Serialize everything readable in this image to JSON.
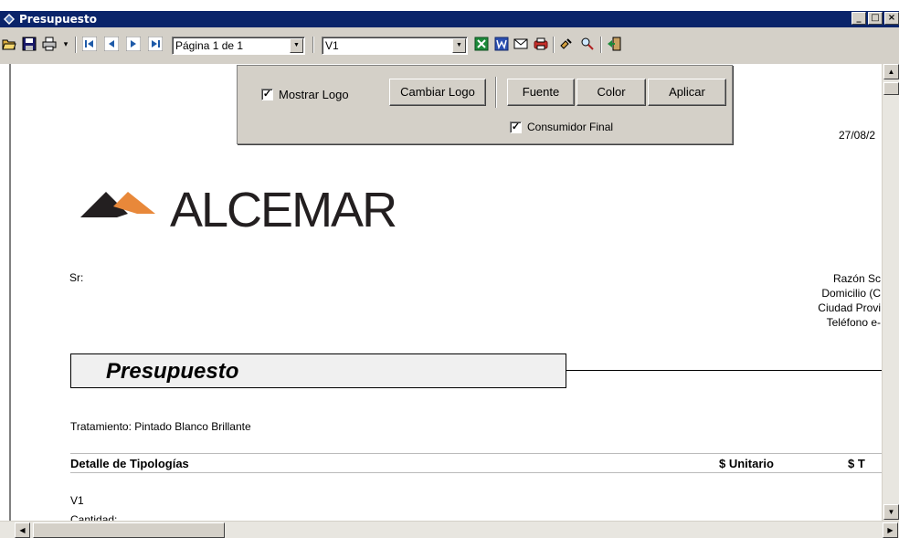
{
  "window": {
    "title": "Presupuesto",
    "buttons": [
      "minimize",
      "maximize",
      "close"
    ]
  },
  "toolbar": {
    "icons": [
      "open-folder-icon",
      "save-icon",
      "print-icon",
      "dropdown-arrow-icon",
      "first-page-icon",
      "prev-page-icon",
      "next-page-icon",
      "last-page-icon",
      "excel-icon",
      "word-icon",
      "email-icon",
      "printer-color-icon",
      "tools-icon",
      "find-icon",
      "exit-icon"
    ],
    "page_combo": "Página 1 de 1",
    "view_combo": "V1"
  },
  "popup": {
    "show_logo_label": "Mostrar Logo",
    "show_logo_checked": true,
    "change_logo": "Cambiar Logo",
    "font": "Fuente",
    "color": "Color",
    "apply": "Aplicar",
    "final_consumer_label": "Consumidor Final",
    "final_consumer_checked": true
  },
  "document": {
    "date": "27/08/2",
    "logo_text": "ALCEMAR",
    "sr_label": "Sr:",
    "company_lines": [
      "Razón Sc",
      "Domicilio (C",
      "Ciudad Provi",
      "Teléfono e-"
    ],
    "title": "Presupuesto",
    "treatment": "Tratamiento: Pintado Blanco Brillante",
    "detail_header": "Detalle de Tipologías",
    "unit_header": "$ Unitario",
    "total_header": "$ T",
    "item": "V1",
    "item_sub": "Cantidad:"
  },
  "colors": {
    "titlebar": "#0a246a",
    "chrome": "#d4d0c8",
    "logo_dark": "#231f20",
    "logo_orange": "#e8883a"
  }
}
